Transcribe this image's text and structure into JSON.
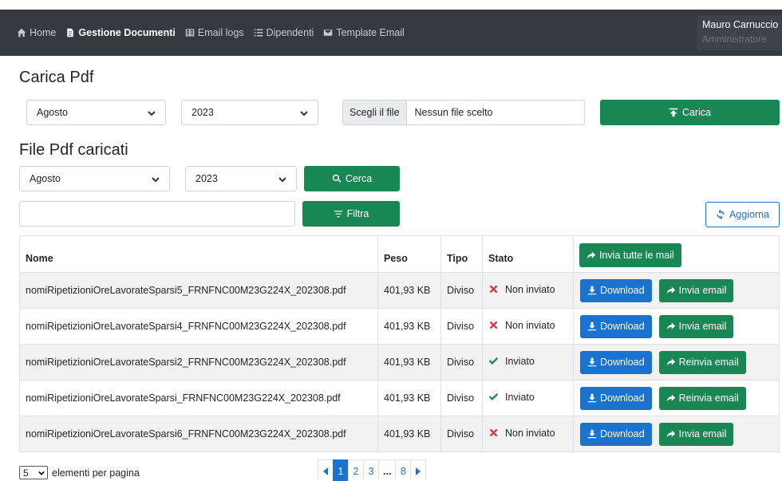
{
  "nav": {
    "items": [
      {
        "label": "Home",
        "icon": "home-icon"
      },
      {
        "label": "Gestione Documenti",
        "icon": "document-icon",
        "active": true
      },
      {
        "label": "Email logs",
        "icon": "table-icon"
      },
      {
        "label": "Dipendenti",
        "icon": "list-icon"
      },
      {
        "label": "Template Email",
        "icon": "envelope-icon"
      }
    ],
    "user_name": "Mauro Carnuccio",
    "user_role": "Amministratore"
  },
  "upload": {
    "title": "Carica Pdf",
    "month": "Agosto",
    "year": "2023",
    "file_button": "Scegli il file",
    "file_status": "Nessun file scelto",
    "submit_label": "Carica"
  },
  "files": {
    "title": "File Pdf caricati",
    "month": "Agosto",
    "year": "2023",
    "search_label": "Cerca",
    "filter_value": "",
    "filter_label": "Filtra",
    "refresh_label": "Aggiorna"
  },
  "table": {
    "headers": {
      "name": "Nome",
      "size": "Peso",
      "type": "Tipo",
      "status": "Stato",
      "send_all": "Invia tutte le mail"
    },
    "rows": [
      {
        "name": "nomiRipetizioniOreLavorateSparsi5_FRNFNC00M23G224X_202308.pdf",
        "size": "401,93 KB",
        "type": "Diviso",
        "status": "Non inviato",
        "sent": false,
        "download": "Download",
        "email": "Invia email"
      },
      {
        "name": "nomiRipetizioniOreLavorateSparsi4_FRNFNC00M23G224X_202308.pdf",
        "size": "401,93 KB",
        "type": "Diviso",
        "status": "Non inviato",
        "sent": false,
        "download": "Download",
        "email": "Invia email"
      },
      {
        "name": "nomiRipetizioniOreLavorateSparsi2_FRNFNC00M23G224X_202308.pdf",
        "size": "401,93 KB",
        "type": "Diviso",
        "status": "Inviato",
        "sent": true,
        "download": "Download",
        "email": "Reinvia email"
      },
      {
        "name": "nomiRipetizioniOreLavorateSparsi_FRNFNC00M23G224X_202308.pdf",
        "size": "401,93 KB",
        "type": "Diviso",
        "status": "Inviato",
        "sent": true,
        "download": "Download",
        "email": "Reinvia email"
      },
      {
        "name": "nomiRipetizioniOreLavorateSparsi6_FRNFNC00M23G224X_202308.pdf",
        "size": "401,93 KB",
        "type": "Diviso",
        "status": "Non inviato",
        "sent": false,
        "download": "Download",
        "email": "Invia email"
      }
    ]
  },
  "footer": {
    "per_page_value": "5",
    "per_page_label": "elementi per pagina",
    "pages": [
      "1",
      "2",
      "3",
      "...",
      "8"
    ],
    "current_page": "1"
  },
  "colors": {
    "navbar": "#343a40",
    "green": "#198754",
    "blue": "#1a73d1",
    "error": "#dc3545",
    "success": "#198754"
  }
}
